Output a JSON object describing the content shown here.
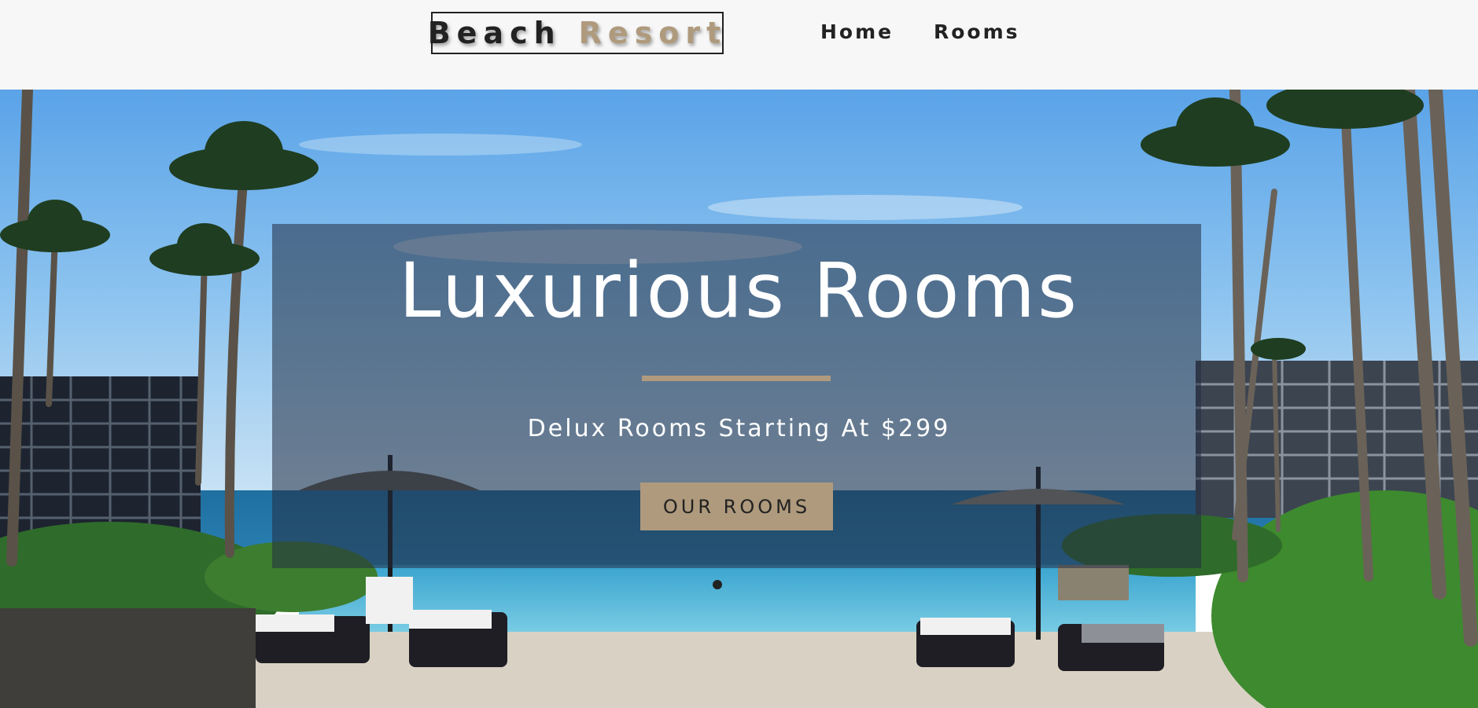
{
  "brand": {
    "word1": "Beach",
    "word2": "Resort",
    "accent_color": "#af9a7d"
  },
  "nav": {
    "links": [
      {
        "label": "Home"
      },
      {
        "label": "Rooms"
      }
    ]
  },
  "hero": {
    "title": "Luxurious Rooms",
    "subtitle": "Delux Rooms Starting At $299",
    "button_label": "OUR ROOMS",
    "background": "tropical-infinity-pool-photo"
  }
}
